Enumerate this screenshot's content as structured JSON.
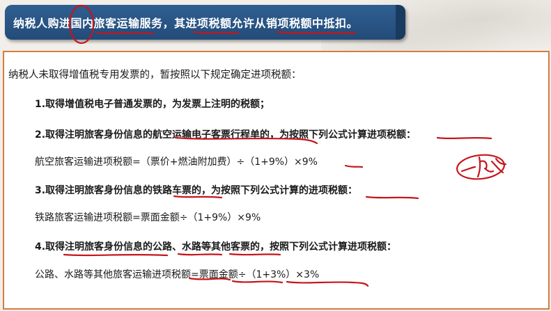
{
  "header": {
    "title": "纳税人购进国内旅客运输服务，其进项税额允许从销项税额中抵扣。"
  },
  "content": {
    "intro": "纳税人未取得增值税专用发票的，暂按照以下规定确定进项税额：",
    "item1": "1.取得增值税电子普通发票的，为发票上注明的税额；",
    "item2": "2.取得注明旅客身份信息的航空运输电子客票行程单的，为按照下列公式计算进项税额：",
    "formula_air": "航空旅客运输进项税额=（票价+燃油附加费）÷（1+9%）×9%",
    "item3": "3.取得注明旅客身份信息的铁路车票的，为按照下列公式计算的进项税额：",
    "formula_rail": "铁路旅客运输进项税额=票面金额÷（1+9%）×9%",
    "item4": "4.取得注明旅客身份信息的公路、水路等其他客票的，按照下列公式计算进项税额：",
    "formula_road": "公路、水路等其他旅客运输进项税额=票面金额÷（1+3%）×3%"
  },
  "annotation": {
    "handwritten_note": "一致",
    "ink_color": "#c4161c"
  }
}
